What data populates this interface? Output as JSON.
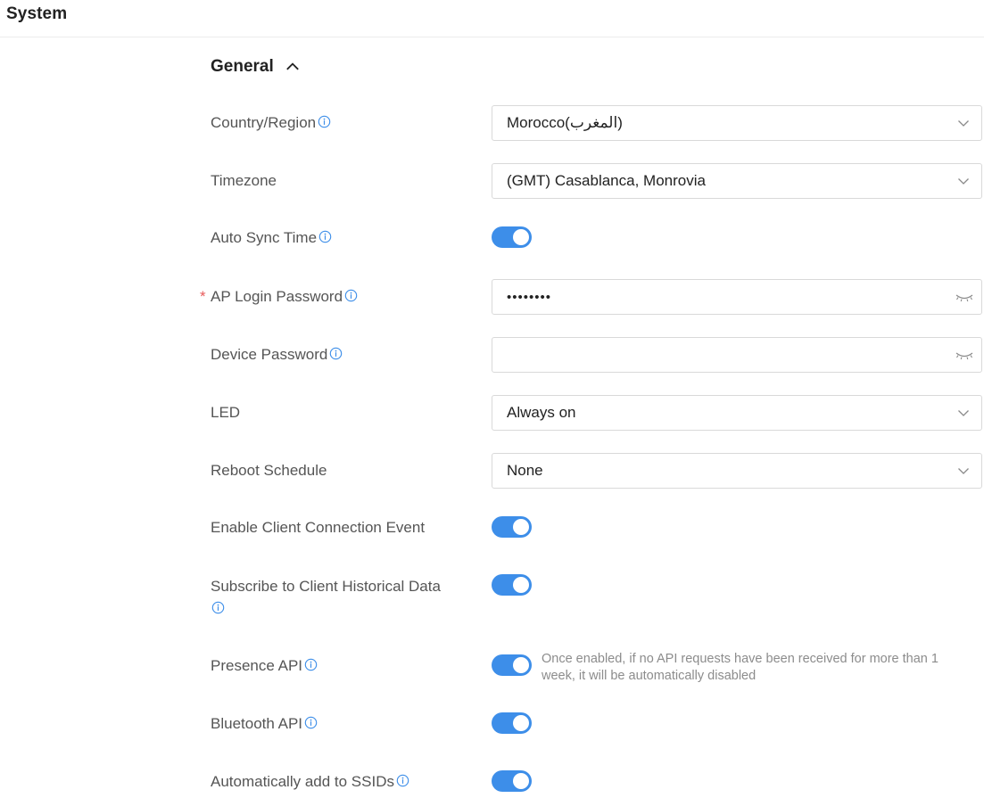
{
  "page": {
    "title": "System"
  },
  "section": {
    "title": "General"
  },
  "colors": {
    "accent": "#3d8ee9",
    "required": "#e85a5a",
    "info": "#3d8ee9"
  },
  "fields": {
    "country": {
      "label": "Country/Region",
      "value": "Morocco(المغرب)"
    },
    "timezone": {
      "label": "Timezone",
      "value": "(GMT) Casablanca, Monrovia"
    },
    "auto_sync": {
      "label": "Auto Sync Time",
      "enabled": true
    },
    "ap_password": {
      "label": "AP Login Password",
      "value": "••••••••",
      "required_mark": "*"
    },
    "device_password": {
      "label": "Device Password",
      "value": ""
    },
    "led": {
      "label": "LED",
      "value": "Always on"
    },
    "reboot": {
      "label": "Reboot Schedule",
      "value": "None"
    },
    "client_event": {
      "label": "Enable Client Connection Event",
      "enabled": true
    },
    "historical": {
      "label": "Subscribe to Client Historical Data",
      "enabled": true
    },
    "presence": {
      "label": "Presence API",
      "enabled": true,
      "hint": "Once enabled, if no API requests have been received for more than 1 week, it will be automatically disabled"
    },
    "bluetooth": {
      "label": "Bluetooth API",
      "enabled": true
    },
    "auto_add": {
      "label": "Automatically add to SSIDs",
      "enabled": true
    }
  },
  "icons": [
    "chevron-up-icon",
    "info-icon",
    "chevron-down-icon",
    "eye-closed-icon"
  ]
}
